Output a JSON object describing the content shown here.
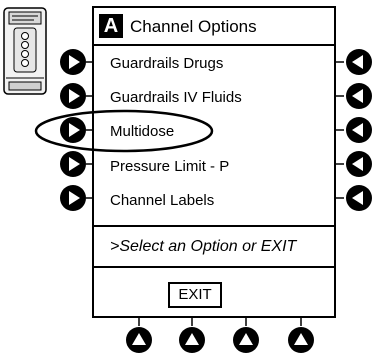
{
  "screen": {
    "channel_letter": "A",
    "title": "Channel Options"
  },
  "options": [
    {
      "label": "Guardrails Drugs"
    },
    {
      "label": "Guardrails IV Fluids"
    },
    {
      "label": "Multidose",
      "highlighted": true
    },
    {
      "label": "Pressure Limit - P"
    },
    {
      "label": "Channel Labels"
    }
  ],
  "prompt": ">Select an Option or EXIT",
  "softkeys": {
    "exit_label": "EXIT"
  },
  "icons": {
    "left_keys": "triangle-right-icon",
    "right_keys": "triangle-left-icon",
    "bottom_keys": "triangle-up-icon",
    "device": "infusion-pump-icon",
    "highlight": "highlight-ellipse"
  },
  "colors": {
    "ink": "#000000",
    "background": "#ffffff"
  }
}
